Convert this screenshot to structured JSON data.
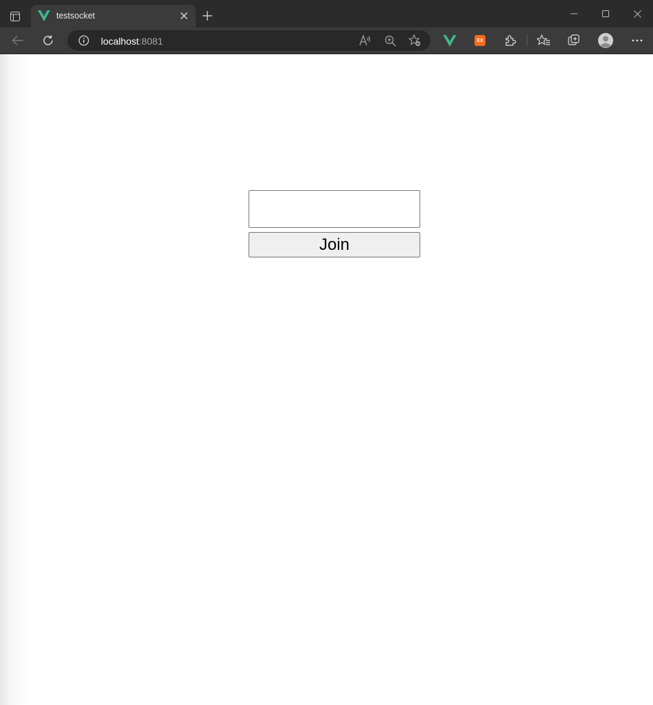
{
  "browser": {
    "tab": {
      "title": "testsocket",
      "favicon": "vue-logo-icon"
    },
    "address_bar": {
      "host": "localhost",
      "port": ":8081"
    },
    "toolbar_icons": [
      "back-icon",
      "refresh-icon",
      "site-info-icon",
      "read-aloud-icon",
      "zoom-icon",
      "add-favorite-icon",
      "vue-devtools-icon",
      "extension-ex-icon",
      "extensions-icon",
      "favorites-icon",
      "collections-icon",
      "profile-avatar",
      "more-icon"
    ],
    "extension_label": "EX",
    "colors": {
      "vue_green": "#41b883",
      "ext_orange": "#f26b1d"
    }
  },
  "page": {
    "name_input": {
      "value": "",
      "placeholder": ""
    },
    "join_label": "Join"
  }
}
